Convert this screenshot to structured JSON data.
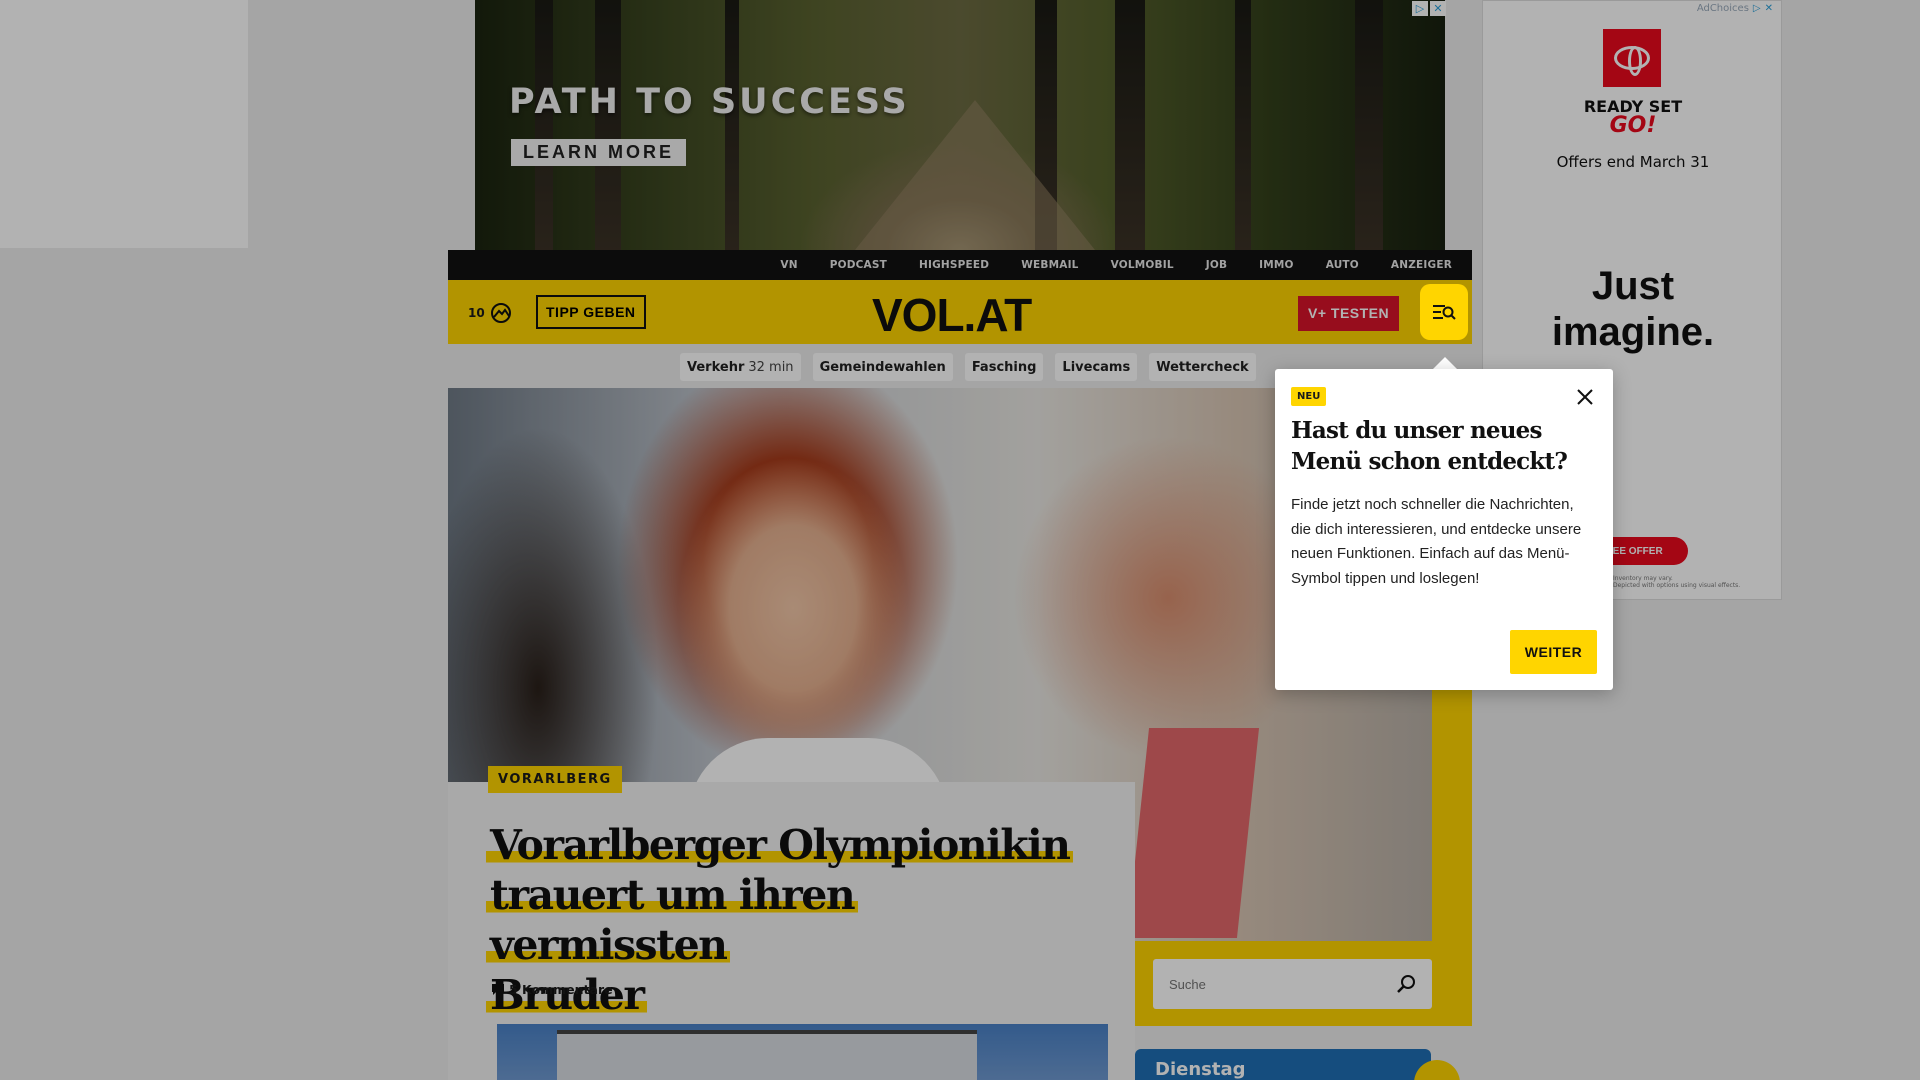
{
  "banner_ad": {
    "headline": "PATH TO SUCCESS",
    "cta": "LEARN MORE"
  },
  "top_nav": {
    "items": [
      "VN",
      "PODCAST",
      "HIGHSPEED",
      "WEBMAIL",
      "VOLMOBIL",
      "JOB",
      "IMMO",
      "AUTO",
      "ANZEIGER"
    ]
  },
  "header": {
    "count": "10",
    "tipp_button": "TIPP GEBEN",
    "logo": "VOL.AT",
    "vplus_button": "V+ TESTEN"
  },
  "quick_links": {
    "traffic_label": "Verkehr",
    "traffic_time": "32 min",
    "items": [
      "Gemeindewahlen",
      "Fasching",
      "Livecams",
      "Wettercheck"
    ]
  },
  "article": {
    "category": "VORARLBERG",
    "headline_lines": [
      "Vorarlberger Olympionikin",
      "trauert um ihren vermissten",
      "Bruder"
    ],
    "comments": "5 Kommentare"
  },
  "search": {
    "placeholder": "Suche"
  },
  "weather": {
    "day": "Dienstag"
  },
  "right_ad": {
    "adchoices": "AdChoices",
    "tagline_1": "READY SET",
    "tagline_2": "GO!",
    "offers": "Offers end March 31",
    "big_text_1": "Just",
    "big_text_2": "imagine.",
    "cta": "SEE OFFER",
    "fine_print_1": "Inventory may vary.",
    "fine_print_2": "Depicted with options using visual effects."
  },
  "popover": {
    "badge": "NEU",
    "title": "Hast du unser neues Menü schon entdeckt?",
    "body": "Finde jetzt noch schneller die Nachrichten, die dich interessieren, und entdecke unsere neuen Funktionen. Einfach auf das Menü-Symbol tippen und loslegen!",
    "button": "WEITER"
  },
  "colors": {
    "brand_yellow": "#ffd500",
    "vplus_red": "#d8142a",
    "toyota_red": "#eb0a1e"
  }
}
